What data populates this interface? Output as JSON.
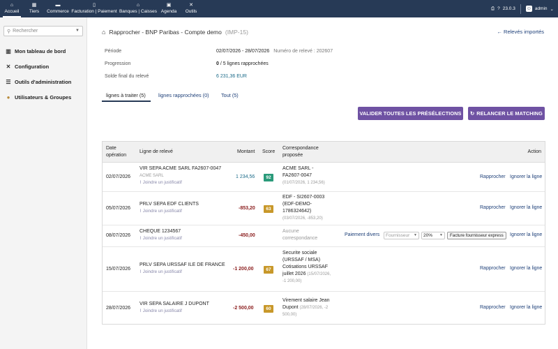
{
  "topbar": {
    "nav": [
      {
        "label": "Accueil",
        "icon": "home-icon"
      },
      {
        "label": "Tiers",
        "icon": "building-icon"
      },
      {
        "label": "Commerce",
        "icon": "briefcase-icon"
      },
      {
        "label": "Facturation | Paiement",
        "icon": "file-invoice-icon"
      },
      {
        "label": "Banques | Caisses",
        "icon": "bank-icon"
      },
      {
        "label": "Agenda",
        "icon": "calendar-icon"
      },
      {
        "label": "Outils",
        "icon": "tools-icon"
      }
    ],
    "version": "23.0.3",
    "user": "admin"
  },
  "sidebar": {
    "search_placeholder": "Rechercher",
    "items": [
      {
        "label": "Mon tableau de bord",
        "icon": "dashboard-icon"
      },
      {
        "label": "Configuration",
        "icon": "wrench-icon"
      },
      {
        "label": "Outils d'administration",
        "icon": "server-icon"
      },
      {
        "label": "Utilisateurs & Groupes",
        "icon": "users-icon"
      }
    ]
  },
  "page": {
    "title": "Rapprocher - BNP Paribas - Compte demo",
    "ref": "(IMP-15)",
    "back_label": "← Relevés importés",
    "info": {
      "periode_label": "Période",
      "periode_value": "02/07/2026 - 28/07/2026",
      "releve_label": "Numéro de relevé : 202607",
      "progression_label": "Progression",
      "progression_count": "0",
      "progression_rest": " / 5 lignes rapprochées",
      "solde_label": "Solde final du relevé",
      "solde_value": "6 231,36 EUR"
    },
    "tabs": [
      "lignes à traiter (5)",
      "lignes rapprochées (0)",
      "Tout (5)"
    ],
    "buttons": {
      "validate": "VALIDER TOUTES LES PRÉSÉLECTIONS",
      "rematch": "RELANCER LE MATCHING"
    }
  },
  "table": {
    "headers": {
      "date_1": "Date",
      "date_2": "opération",
      "ligne": "Ligne de relevé",
      "montant": "Montant",
      "score": "Score",
      "corr_1": "Correspondance",
      "corr_2": "proposée",
      "action": "Action"
    },
    "justif": "Joindre un justificatif",
    "rows": [
      {
        "date": "02/07/2026",
        "libelle": "VIR SEPA ACME SARL FA2607-0047",
        "tiers": "ACME SARL",
        "montant": "1 234,56",
        "score": "92",
        "corr_lines": [
          "ACME SARL -",
          "FA2607-0047"
        ],
        "corr_sub": "(01/07/2026, 1 234,56)",
        "rapprocher": "Rapprocher",
        "ignorer": "Ignorer la ligne"
      },
      {
        "date": "05/07/2026",
        "libelle": "PRLV SEPA EDF CLIENTS",
        "montant": "-853,20",
        "score": "63",
        "corr_lines": [
          "EDF - SI2607-0003",
          "(EDF-DEMO-",
          "1786324642)"
        ],
        "corr_sub": "(03/07/2026, -853,20)",
        "rapprocher": "Rapprocher",
        "ignorer": "Ignorer la ligne"
      },
      {
        "date": "08/07/2026",
        "libelle": "CHEQUE 1234567",
        "montant": "-450,00",
        "corr_lines": [
          "Aucune",
          "correspondance"
        ],
        "paiement_divers": "Paiement divers",
        "fournisseur_placeholder": "Fournisseur",
        "tva": "20%",
        "facture_express": "Facture fournisseur express",
        "ignorer": "Ignorer la ligne"
      },
      {
        "date": "15/07/2026",
        "libelle": "PRLV SEPA URSSAF ILE DE FRANCE",
        "montant": "-1 200,00",
        "score": "67",
        "corr_lines": [
          "Securite sociale",
          "(URSSAF / MSA)",
          "Cotisations URSSAF"
        ],
        "corr_last": "juillet 2026",
        "corr_last_sub": "(15/07/2026,",
        "corr_sub": "-1 200,00)",
        "rapprocher": "Rapprocher",
        "ignorer": "Ignorer la ligne"
      },
      {
        "date": "28/07/2026",
        "libelle": "VIR SEPA SALAIRE J DUPONT",
        "montant": "-2 500,00",
        "score": "60",
        "corr_lines": [
          "Virement salaire Jean"
        ],
        "corr_last": "Dupont",
        "corr_last_sub": "(28/07/2026, -2",
        "corr_sub": "500,00)",
        "rapprocher": "Rapprocher",
        "ignorer": "Ignorer la ligne"
      }
    ]
  }
}
